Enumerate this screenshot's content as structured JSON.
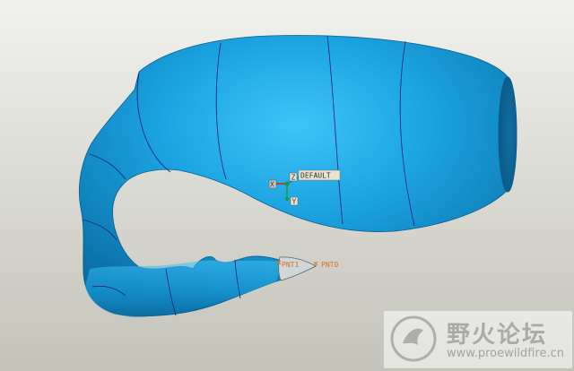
{
  "viewport": {
    "background_top": "#f1f1ee",
    "background_bottom": "#c3c3b9",
    "model_color": "#1aa3e0"
  },
  "csys": {
    "name": "DEFAULT",
    "axes": [
      "X",
      "Y",
      "Z"
    ]
  },
  "datum_points": [
    "PNT1",
    "PNT0"
  ],
  "watermark": {
    "title": "野火论坛",
    "url": "www.proewildfire.cn"
  }
}
